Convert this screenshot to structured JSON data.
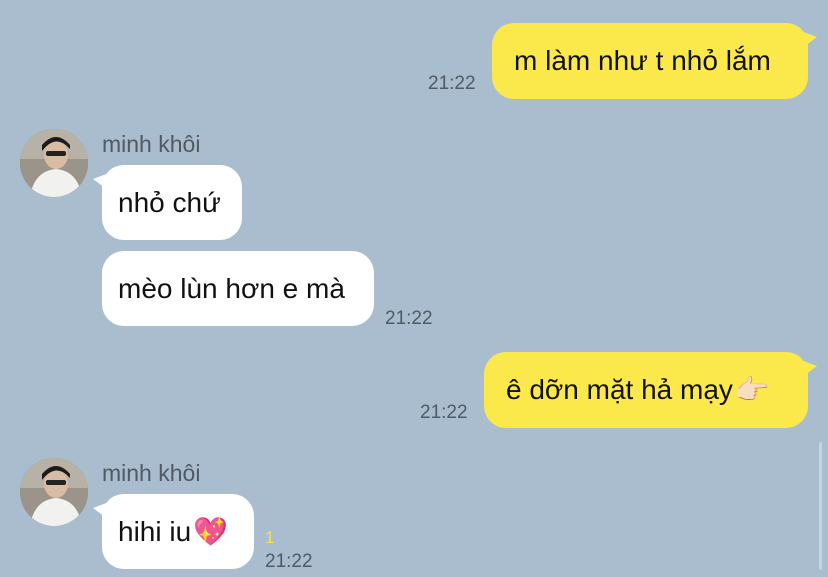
{
  "colors": {
    "background": "#a9bdce",
    "outgoing_bubble": "#fbe94b",
    "incoming_bubble": "#ffffff",
    "timestamp": "#4f5a64",
    "unread_count": "#f6e24a"
  },
  "messages": [
    {
      "direction": "outgoing",
      "text": "m làm như t nhỏ lắm",
      "time": "21:22"
    },
    {
      "direction": "incoming",
      "sender": "minh khôi",
      "avatar_icon": "profile-photo",
      "bubbles": [
        {
          "text": "nhỏ chứ"
        },
        {
          "text": "mèo lùn hơn e mà"
        }
      ],
      "time": "21:22"
    },
    {
      "direction": "outgoing",
      "text": "ê dỡn mặt hả mạy",
      "emoji": "👉🏻",
      "emoji_icon": "pointing-hand-icon",
      "time": "21:22"
    },
    {
      "direction": "incoming",
      "sender": "minh khôi",
      "avatar_icon": "profile-photo",
      "bubbles": [
        {
          "text": "hihi iu",
          "emoji": "💖",
          "emoji_icon": "sparkling-heart-icon"
        }
      ],
      "unread": "1",
      "time": "21:22"
    }
  ]
}
